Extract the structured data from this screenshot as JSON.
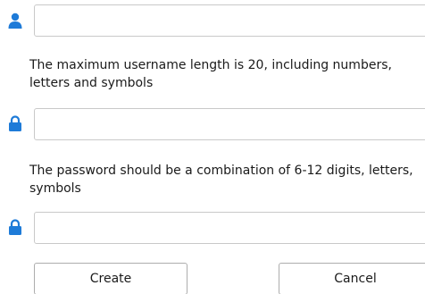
{
  "icons": {
    "username": "user-icon",
    "password": "lock-icon",
    "confirm_password": "lock-icon",
    "accent_color": "#1e7bd8"
  },
  "username": {
    "value": "",
    "hint": "The maximum username length is 20, including numbers, letters and symbols"
  },
  "password": {
    "value": "",
    "hint": "The password should be a combination of 6-12 digits, letters, symbols"
  },
  "confirm_password": {
    "value": ""
  },
  "buttons": {
    "create_label": "Create",
    "cancel_label": "Cancel"
  }
}
